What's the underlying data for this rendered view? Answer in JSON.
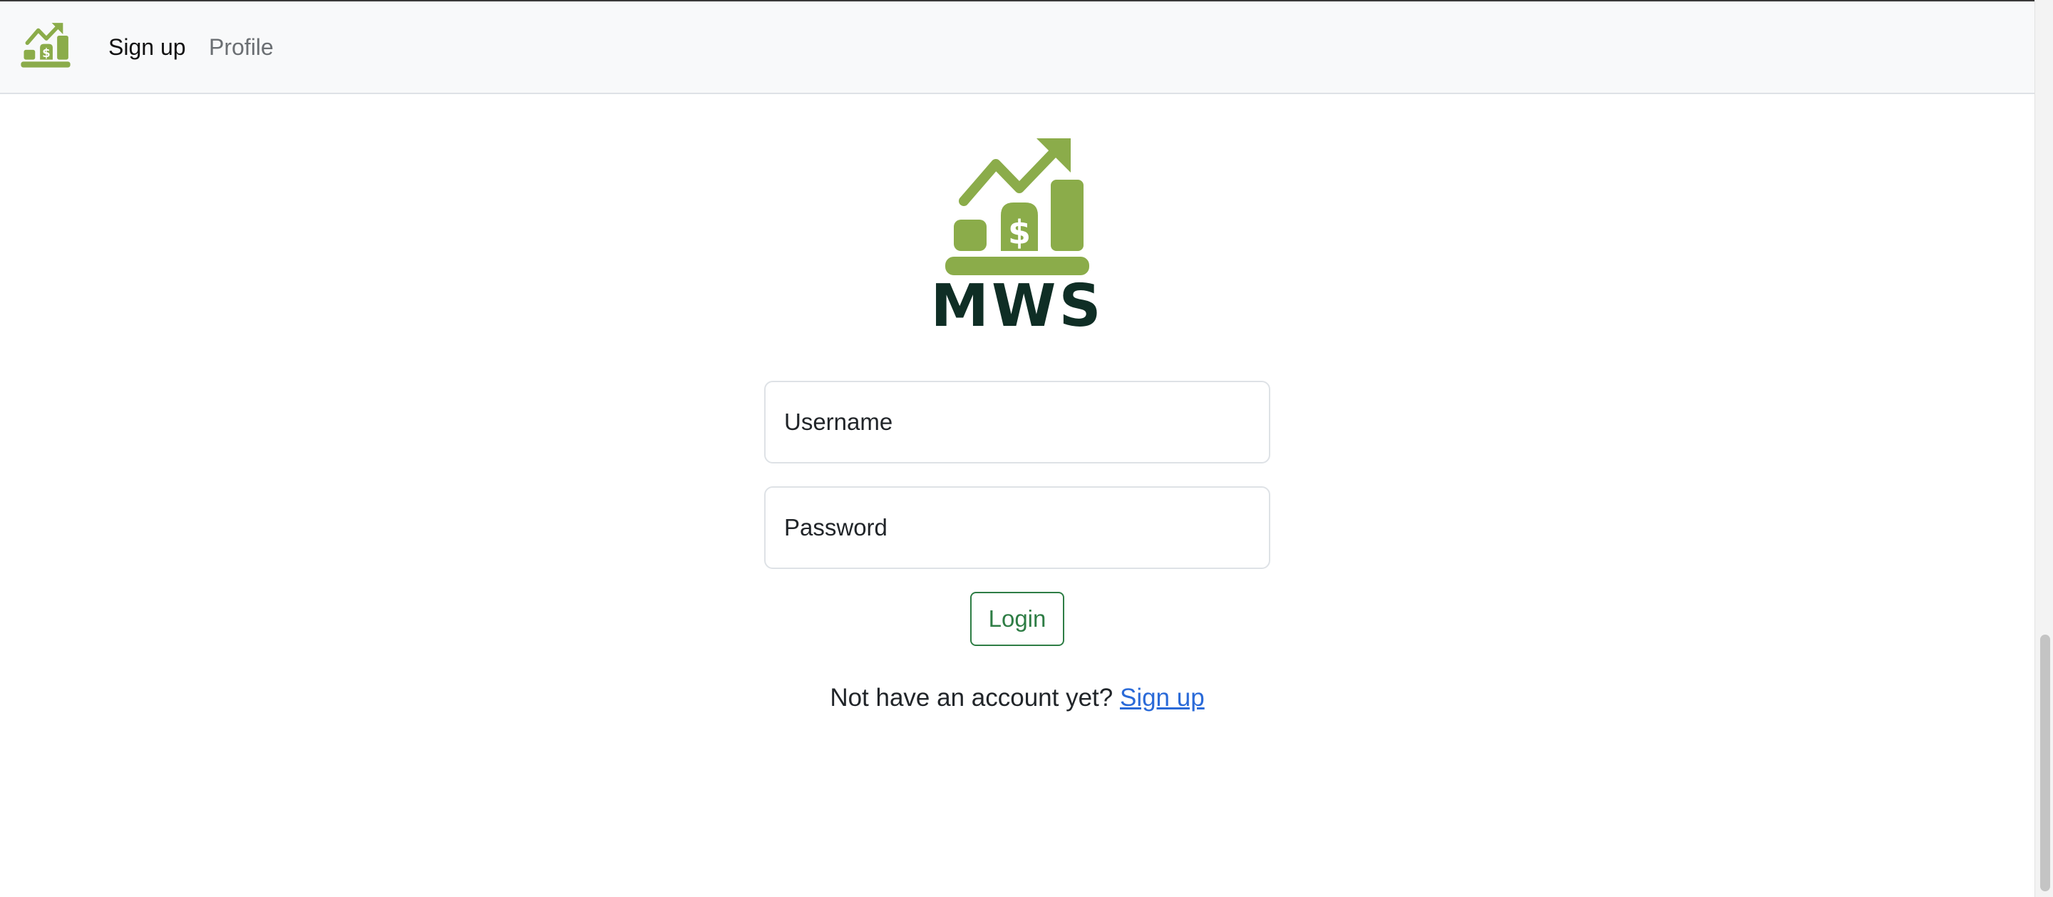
{
  "colors": {
    "brand_green": "#8bac4a",
    "brand_dark": "#0f2e25",
    "navbar_bg": "#f8f9fa",
    "button_green": "#2e7d45",
    "link_blue": "#2a6ad8"
  },
  "navbar": {
    "logo_icon": "growth-chart-dollar-icon",
    "links": [
      {
        "label": "Sign up"
      },
      {
        "label": "Profile"
      }
    ]
  },
  "hero": {
    "logo_icon": "growth-chart-dollar-icon",
    "brand_name": "MWS"
  },
  "login_form": {
    "username": {
      "placeholder": "Username",
      "value": ""
    },
    "password": {
      "placeholder": "Password",
      "value": ""
    },
    "submit_label": "Login"
  },
  "footer_prompt": {
    "text": "Not have an account yet?",
    "link_label": "Sign up"
  }
}
